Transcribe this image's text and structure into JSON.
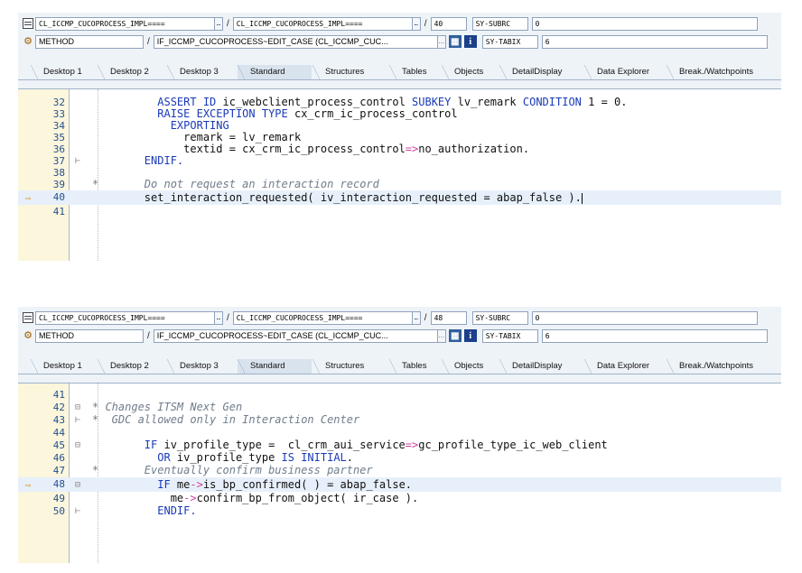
{
  "panels": [
    {
      "program": "CL_ICCMP_CUCOPROCESS_IMPL====",
      "include": "CL_ICCMP_CUCOPROCESS_IMPL====",
      "line_no": "40",
      "var1_name": "SY-SUBRC",
      "var1_value": "0",
      "event_type": "METHOD",
      "event_name": "IF_ICCMP_CUCOPROCESS~EDIT_CASE (CL_ICCMP_CUC...",
      "var2_name": "SY-TABIX",
      "var2_value": "6",
      "tabs": [
        "Desktop 1",
        "Desktop 2",
        "Desktop 3",
        "Standard",
        "Structures",
        "Tables",
        "Objects",
        "DetailDisplay",
        "Data Explorer",
        "Break./Watchpoints"
      ],
      "active_tab": "Standard",
      "lines": [
        {
          "num": "32",
          "text": "          ASSERT ID ic_webclient_process_control SUBKEY lv_remark CONDITION 1 = 0."
        },
        {
          "num": "33",
          "text": "          RAISE EXCEPTION TYPE cx_crm_ic_process_control"
        },
        {
          "num": "34",
          "text": "            EXPORTING"
        },
        {
          "num": "35",
          "text": "              remark = lv_remark"
        },
        {
          "num": "36",
          "text": "              textid = cx_crm_ic_process_control=>no_authorization."
        },
        {
          "num": "37",
          "text": "        ENDIF."
        },
        {
          "num": "38",
          "text": ""
        },
        {
          "num": "39",
          "text": "*       Do not request an interaction record"
        },
        {
          "num": "40",
          "text": "        set_interaction_requested( iv_interaction_requested = abap_false )."
        },
        {
          "num": "41",
          "text": ""
        }
      ],
      "current_line": "40"
    },
    {
      "program": "CL_ICCMP_CUCOPROCESS_IMPL====",
      "include": "CL_ICCMP_CUCOPROCESS_IMPL====",
      "line_no": "48",
      "var1_name": "SY-SUBRC",
      "var1_value": "0",
      "event_type": "METHOD",
      "event_name": "IF_ICCMP_CUCOPROCESS~EDIT_CASE (CL_ICCMP_CUC...",
      "var2_name": "SY-TABIX",
      "var2_value": "6",
      "tabs": [
        "Desktop 1",
        "Desktop 2",
        "Desktop 3",
        "Standard",
        "Structures",
        "Tables",
        "Objects",
        "DetailDisplay",
        "Data Explorer",
        "Break./Watchpoints"
      ],
      "active_tab": "Standard",
      "lines": [
        {
          "num": "41",
          "text": ""
        },
        {
          "num": "42",
          "text": "* Changes ITSM Next Gen"
        },
        {
          "num": "43",
          "text": "*  GDC allowed only in Interaction Center"
        },
        {
          "num": "44",
          "text": ""
        },
        {
          "num": "45",
          "text": "        IF iv_profile_type =  cl_crm_aui_service=>gc_profile_type_ic_web_client"
        },
        {
          "num": "46",
          "text": "          OR iv_profile_type IS INITIAL."
        },
        {
          "num": "47",
          "text": "*       Eventually confirm business partner"
        },
        {
          "num": "48",
          "text": "          IF me->is_bp_confirmed( ) = abap_false."
        },
        {
          "num": "49",
          "text": "            me->confirm_bp_from_object( ir_case )."
        },
        {
          "num": "50",
          "text": "          ENDIF."
        }
      ],
      "current_line": "48"
    }
  ],
  "icons": {
    "program_icon": "table-icon",
    "event_icon": "method-icon",
    "env_icon": "environment-icon",
    "info_icon": "info-icon",
    "current_line_arrow": "arrow-right-icon"
  },
  "colors": {
    "header_bg": "#eef3f8",
    "gutter_bg": "#fbf6dc",
    "keyword": "#1a3ab8",
    "comment": "#6f7d8c",
    "current_line_bg": "#e7f0fa"
  }
}
